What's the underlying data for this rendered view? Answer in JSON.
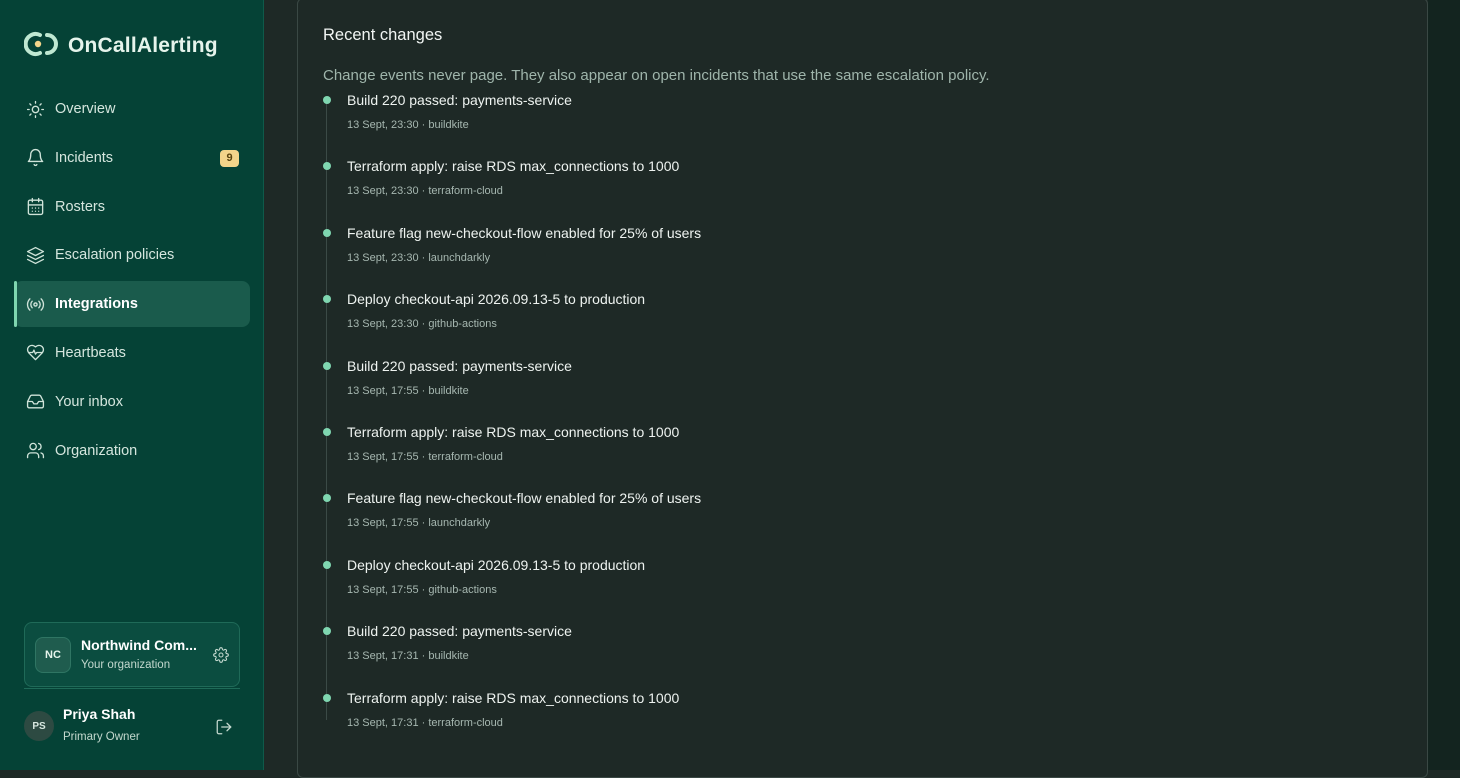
{
  "app": {
    "name": "OnCallAlerting",
    "brand_color": "#7fd6b0"
  },
  "sidebar": {
    "items": [
      {
        "label": "Overview",
        "icon": "sun-icon"
      },
      {
        "label": "Incidents",
        "icon": "bell-icon",
        "badge": "9"
      },
      {
        "label": "Rosters",
        "icon": "calendar-icon"
      },
      {
        "label": "Escalation policies",
        "icon": "layers-icon"
      },
      {
        "label": "Integrations",
        "icon": "broadcast-icon",
        "active": true
      },
      {
        "label": "Heartbeats",
        "icon": "heart-pulse-icon"
      },
      {
        "label": "Your inbox",
        "icon": "inbox-icon"
      },
      {
        "label": "Organization",
        "icon": "users-icon"
      }
    ],
    "org": {
      "initials": "NC",
      "name": "Northwind Com...",
      "subtitle": "Your organization"
    },
    "user": {
      "initials": "PS",
      "name": "Priya Shah",
      "role": "Primary Owner"
    }
  },
  "main": {
    "title": "Recent changes",
    "description": "Change events never page. They also appear on open incidents that use the same escalation policy.",
    "events": [
      {
        "title": "Build 220 passed: payments-service",
        "meta": "13 Sept, 23:30 · buildkite"
      },
      {
        "title": "Terraform apply: raise RDS max_connections to 1000",
        "meta": "13 Sept, 23:30 · terraform-cloud"
      },
      {
        "title": "Feature flag new-checkout-flow enabled for 25% of users",
        "meta": "13 Sept, 23:30 · launchdarkly"
      },
      {
        "title": "Deploy checkout-api 2026.09.13-5 to production",
        "meta": "13 Sept, 23:30 · github-actions"
      },
      {
        "title": "Build 220 passed: payments-service",
        "meta": "13 Sept, 17:55 · buildkite"
      },
      {
        "title": "Terraform apply: raise RDS max_connections to 1000",
        "meta": "13 Sept, 17:55 · terraform-cloud"
      },
      {
        "title": "Feature flag new-checkout-flow enabled for 25% of users",
        "meta": "13 Sept, 17:55 · launchdarkly"
      },
      {
        "title": "Deploy checkout-api 2026.09.13-5 to production",
        "meta": "13 Sept, 17:55 · github-actions"
      },
      {
        "title": "Build 220 passed: payments-service",
        "meta": "13 Sept, 17:31 · buildkite"
      },
      {
        "title": "Terraform apply: raise RDS max_connections to 1000",
        "meta": "13 Sept, 17:31 · terraform-cloud"
      }
    ]
  }
}
